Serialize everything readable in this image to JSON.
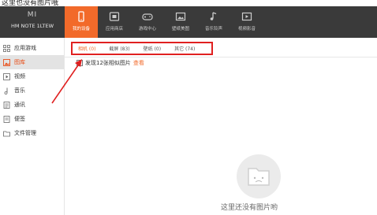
{
  "header": {
    "cutoff_text": "这里也没有图片哦",
    "brand_logo": "MI",
    "device_model": "HM NOTE 1LTEW"
  },
  "nav": [
    {
      "label": "我的设备",
      "icon": "phone-icon",
      "active": true
    },
    {
      "label": "应用商店",
      "icon": "store-icon",
      "active": false
    },
    {
      "label": "游戏中心",
      "icon": "gamepad-icon",
      "active": false
    },
    {
      "label": "壁纸美图",
      "icon": "wallpaper-icon",
      "active": false
    },
    {
      "label": "音乐铃声",
      "icon": "music-icon",
      "active": false
    },
    {
      "label": "视频影音",
      "icon": "video-icon",
      "active": false
    }
  ],
  "sidebar": [
    {
      "label": "应用游戏",
      "icon": "apps-icon",
      "active": false
    },
    {
      "label": "图库",
      "icon": "image-icon",
      "active": true
    },
    {
      "label": "视频",
      "icon": "play-icon",
      "active": false
    },
    {
      "label": "音乐",
      "icon": "note-icon",
      "active": false
    },
    {
      "label": "通讯",
      "icon": "contacts-icon",
      "active": false
    },
    {
      "label": "便签",
      "icon": "memo-icon",
      "active": false
    },
    {
      "label": "文件管理",
      "icon": "folder-icon",
      "active": false
    }
  ],
  "tabs": [
    {
      "label": "相机 (0)",
      "active": true
    },
    {
      "label": "截屏 (83)",
      "active": false
    },
    {
      "label": "壁纸 (0)",
      "active": false
    },
    {
      "label": "其它 (74)",
      "active": false
    }
  ],
  "notice": {
    "text": "发现12张相似图片",
    "link": "查看"
  },
  "empty": {
    "text": "这里还没有图片哟"
  },
  "colors": {
    "accent": "#f26a2a",
    "annotation": "#e02020",
    "topbar": "#3a3a3a"
  }
}
